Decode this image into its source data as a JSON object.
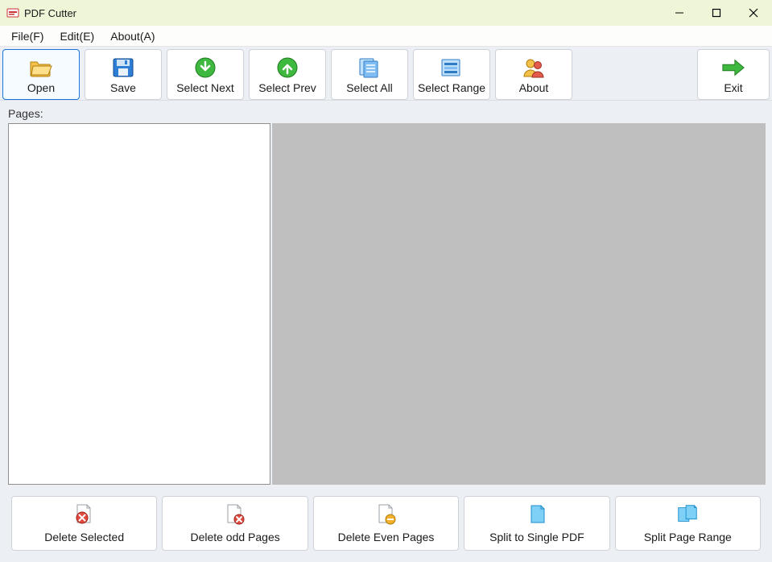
{
  "window": {
    "title": "PDF Cutter"
  },
  "menu": {
    "file": "File(F)",
    "edit": "Edit(E)",
    "about": "About(A)"
  },
  "toolbar": {
    "open": "Open",
    "save": "Save",
    "select_next": "Select Next",
    "select_prev": "Select Prev",
    "select_all": "Select All",
    "select_range": "Select Range",
    "about": "About",
    "exit": "Exit"
  },
  "labels": {
    "pages": "Pages:"
  },
  "bottom": {
    "delete_selected": "Delete Selected",
    "delete_odd": "Delete odd Pages",
    "delete_even": "Delete Even Pages",
    "split_single": "Split to Single PDF",
    "split_range": "Split Page Range"
  }
}
